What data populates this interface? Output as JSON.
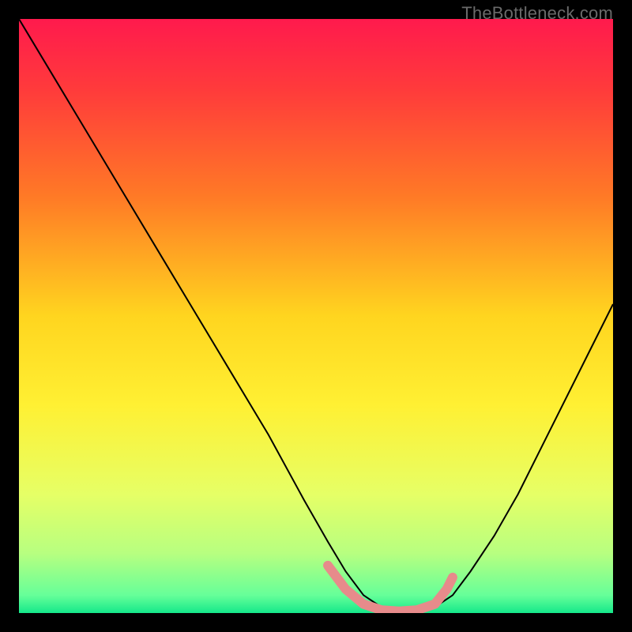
{
  "watermark": "TheBottleneck.com",
  "chart_data": {
    "type": "line",
    "title": "",
    "xlabel": "",
    "ylabel": "",
    "xlim": [
      0,
      100
    ],
    "ylim": [
      0,
      100
    ],
    "background": {
      "kind": "vertical-gradient",
      "stops": [
        {
          "offset": 0.0,
          "color": "#ff1a4d"
        },
        {
          "offset": 0.12,
          "color": "#ff3b3b"
        },
        {
          "offset": 0.3,
          "color": "#ff7a26"
        },
        {
          "offset": 0.5,
          "color": "#ffd51f"
        },
        {
          "offset": 0.65,
          "color": "#fff033"
        },
        {
          "offset": 0.8,
          "color": "#e6ff66"
        },
        {
          "offset": 0.9,
          "color": "#b7ff80"
        },
        {
          "offset": 0.97,
          "color": "#66ff99"
        },
        {
          "offset": 1.0,
          "color": "#15e88a"
        }
      ]
    },
    "series": [
      {
        "name": "bottleneck-curve",
        "color": "#000000",
        "stroke_width": 2,
        "x": [
          0,
          6,
          12,
          18,
          24,
          30,
          36,
          42,
          48,
          52,
          55,
          58,
          61,
          64,
          67,
          70,
          73,
          76,
          80,
          84,
          88,
          92,
          96,
          100
        ],
        "y": [
          100,
          90,
          80,
          70,
          60,
          50,
          40,
          30,
          19,
          12,
          7,
          3,
          1,
          0,
          0,
          1,
          3,
          7,
          13,
          20,
          28,
          36,
          44,
          52
        ]
      },
      {
        "name": "marker-band",
        "color": "#e78b8b",
        "stroke_width": 12,
        "linecap": "round",
        "x": [
          52,
          55,
          58,
          61,
          64,
          67,
          70,
          72,
          73
        ],
        "y": [
          8,
          4,
          1.5,
          0.5,
          0.3,
          0.5,
          1.5,
          4,
          6
        ]
      }
    ]
  }
}
